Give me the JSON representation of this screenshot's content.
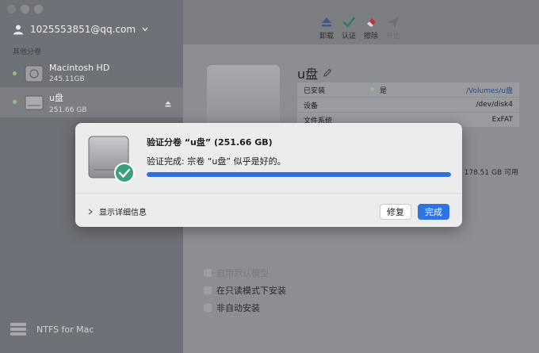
{
  "sidebar": {
    "account": "1025553851@qq.com",
    "section_label": "其他分卷",
    "volumes": [
      {
        "name": "Macintosh HD",
        "size": "245.11GB"
      },
      {
        "name": "u盘",
        "size": "251.66 GB"
      }
    ],
    "app_name": "NTFS for Mac"
  },
  "toolbar": {
    "items": [
      {
        "label": "卸载",
        "icon": "eject-icon",
        "enabled": true
      },
      {
        "label": "认证",
        "icon": "checkmark-icon",
        "enabled": true
      },
      {
        "label": "擦除",
        "icon": "eraser-icon",
        "enabled": true
      },
      {
        "label": "开始",
        "icon": "paper-plane-icon",
        "enabled": false
      }
    ]
  },
  "main": {
    "volume_title": "u盘",
    "info": {
      "rows": [
        {
          "label": "已安装",
          "status": "是",
          "value": "/Volumes/u盘"
        },
        {
          "label": "设备",
          "value": "/dev/disk4"
        },
        {
          "label": "文件系统",
          "value": "ExFAT"
        }
      ]
    },
    "available": "178.51 GB 可用",
    "options": [
      {
        "label": "启用默认模型",
        "faded": true
      },
      {
        "label": "在只读模式下安装",
        "faded": false
      },
      {
        "label": "非自动安装",
        "faded": false
      }
    ]
  },
  "dialog": {
    "title": "验证分卷 “u盘” (251.66 GB)",
    "message": "验证完成: 宗卷 “u盘” 似乎是好的。",
    "progress_percent": 100,
    "details_label": "显示详细信息",
    "repair_label": "修复",
    "done_label": "完成"
  },
  "colors": {
    "accent": "#2f74e0",
    "success": "#3aa07a",
    "status_green": "#8fbf8a"
  }
}
